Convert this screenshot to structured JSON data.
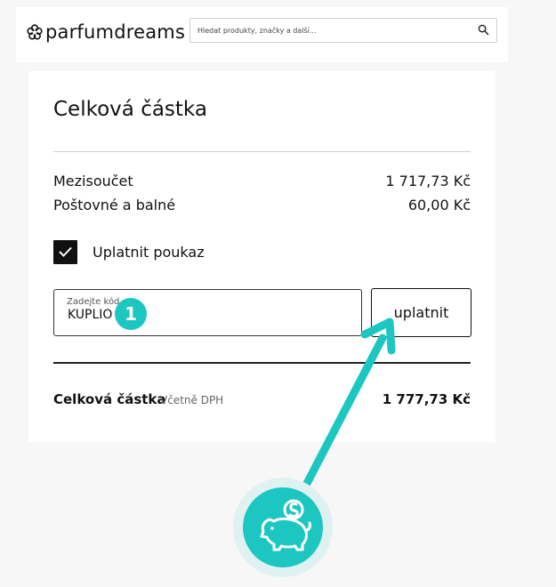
{
  "header": {
    "logo_text": "parfumdreams",
    "search_placeholder": "Hledat produkty, značky a další..."
  },
  "summary": {
    "title": "Celková částka",
    "rows": [
      {
        "label": "Mezisoučet",
        "value": "1 717,73 Kč"
      },
      {
        "label": "Poštovné a balné",
        "value": "60,00 Kč"
      }
    ],
    "voucher_checkbox_label": "Uplatnit poukaz",
    "voucher_checked": true,
    "code_field_label": "Zadejte kód",
    "code_field_value": "KUPLIO",
    "apply_button_label": "uplatnit",
    "total_label": "Celková částka",
    "total_sublabel": "Včetně DPH",
    "total_value": "1 777,73 Kč"
  },
  "annotation": {
    "step_number": "1",
    "accent_color": "#1cc7c1",
    "icon": "piggy-bank-coin-icon"
  }
}
